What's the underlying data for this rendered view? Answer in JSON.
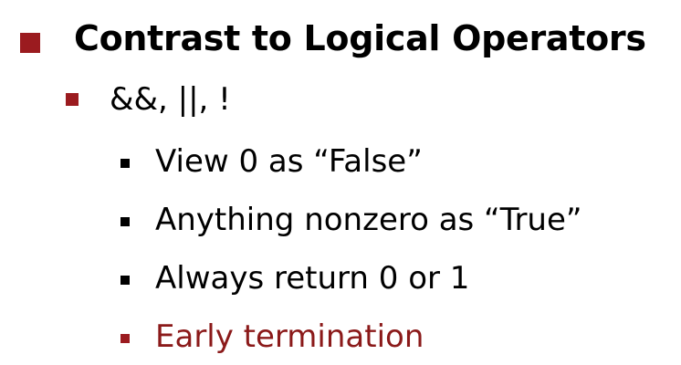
{
  "slide": {
    "heading": "Contrast to Logical Operators",
    "subheading": "&&, ||, !",
    "points": [
      "View 0 as “False”",
      "Anything nonzero as “True”",
      "Always return 0 or 1",
      "Early termination"
    ]
  },
  "colors": {
    "accent": "#9b1b1f",
    "text": "#000000",
    "highlight_text": "#8b1a1a"
  }
}
